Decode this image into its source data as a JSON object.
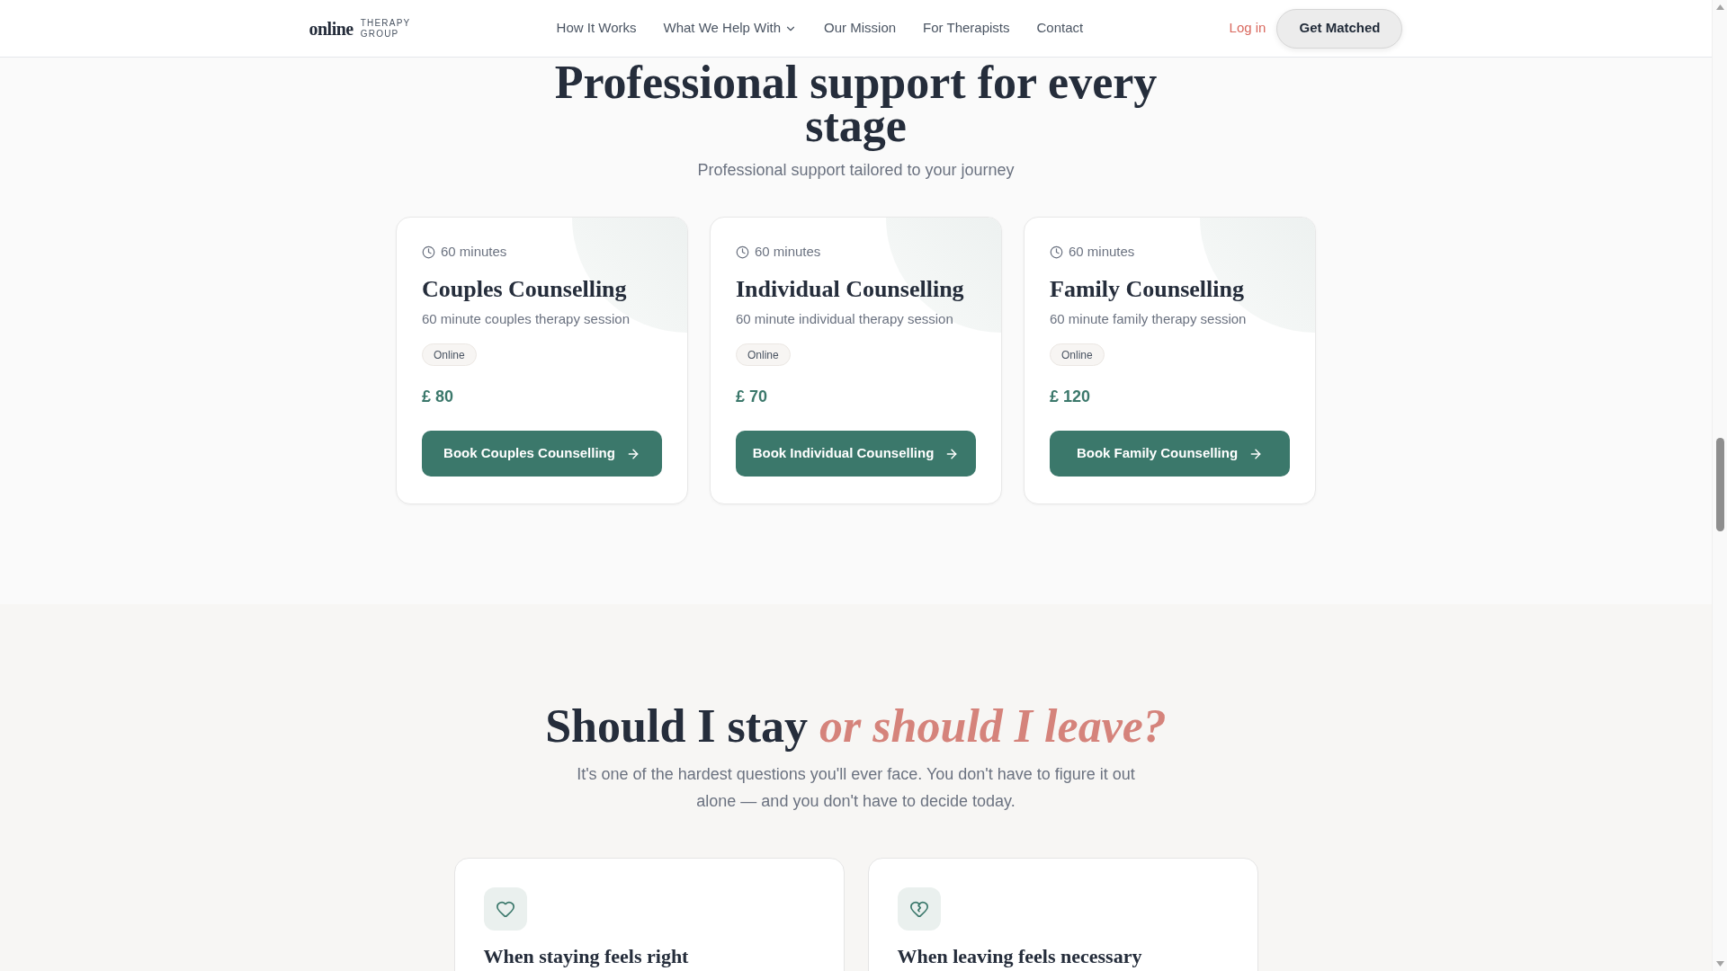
{
  "header": {
    "logo": {
      "wordmark": "online",
      "tagline": "THERAPY GROUP"
    },
    "nav": [
      {
        "label": "How It Works",
        "kind": "link"
      },
      {
        "label": "What We Help With",
        "kind": "dropdown"
      },
      {
        "label": "Our Mission",
        "kind": "link"
      },
      {
        "label": "For Therapists",
        "kind": "link"
      },
      {
        "label": "Contact",
        "kind": "link"
      }
    ],
    "login": "Log in",
    "cta": "Get Matched"
  },
  "services": {
    "title": "Professional support for every stage",
    "subtitle": "Professional support tailored to your journey",
    "cards": [
      {
        "duration": "60 minutes",
        "title": "Couples Counselling",
        "description": "60 minute couples therapy session",
        "badge": "Online",
        "price": "£ 80",
        "button": "Book Couples Counselling"
      },
      {
        "duration": "60 minutes",
        "title": "Individual Counselling",
        "description": "60 minute individual therapy session",
        "badge": "Online",
        "price": "£ 70",
        "button": "Book Individual Counselling"
      },
      {
        "duration": "60 minutes",
        "title": "Family Counselling",
        "description": "60 minute family therapy session",
        "badge": "Online",
        "price": "£ 120",
        "button": "Book Family Counselling"
      }
    ]
  },
  "decision": {
    "title": "Should I stay *or should I leave?*",
    "intro": "It's one of the hardest questions you'll ever face. You don't have to figure it out alone — and you don't have to decide today.",
    "cards": [
      {
        "kind": "stay",
        "title": "When staying feels right"
      },
      {
        "kind": "leave",
        "title": "When leaving feels necessary"
      }
    ]
  }
}
